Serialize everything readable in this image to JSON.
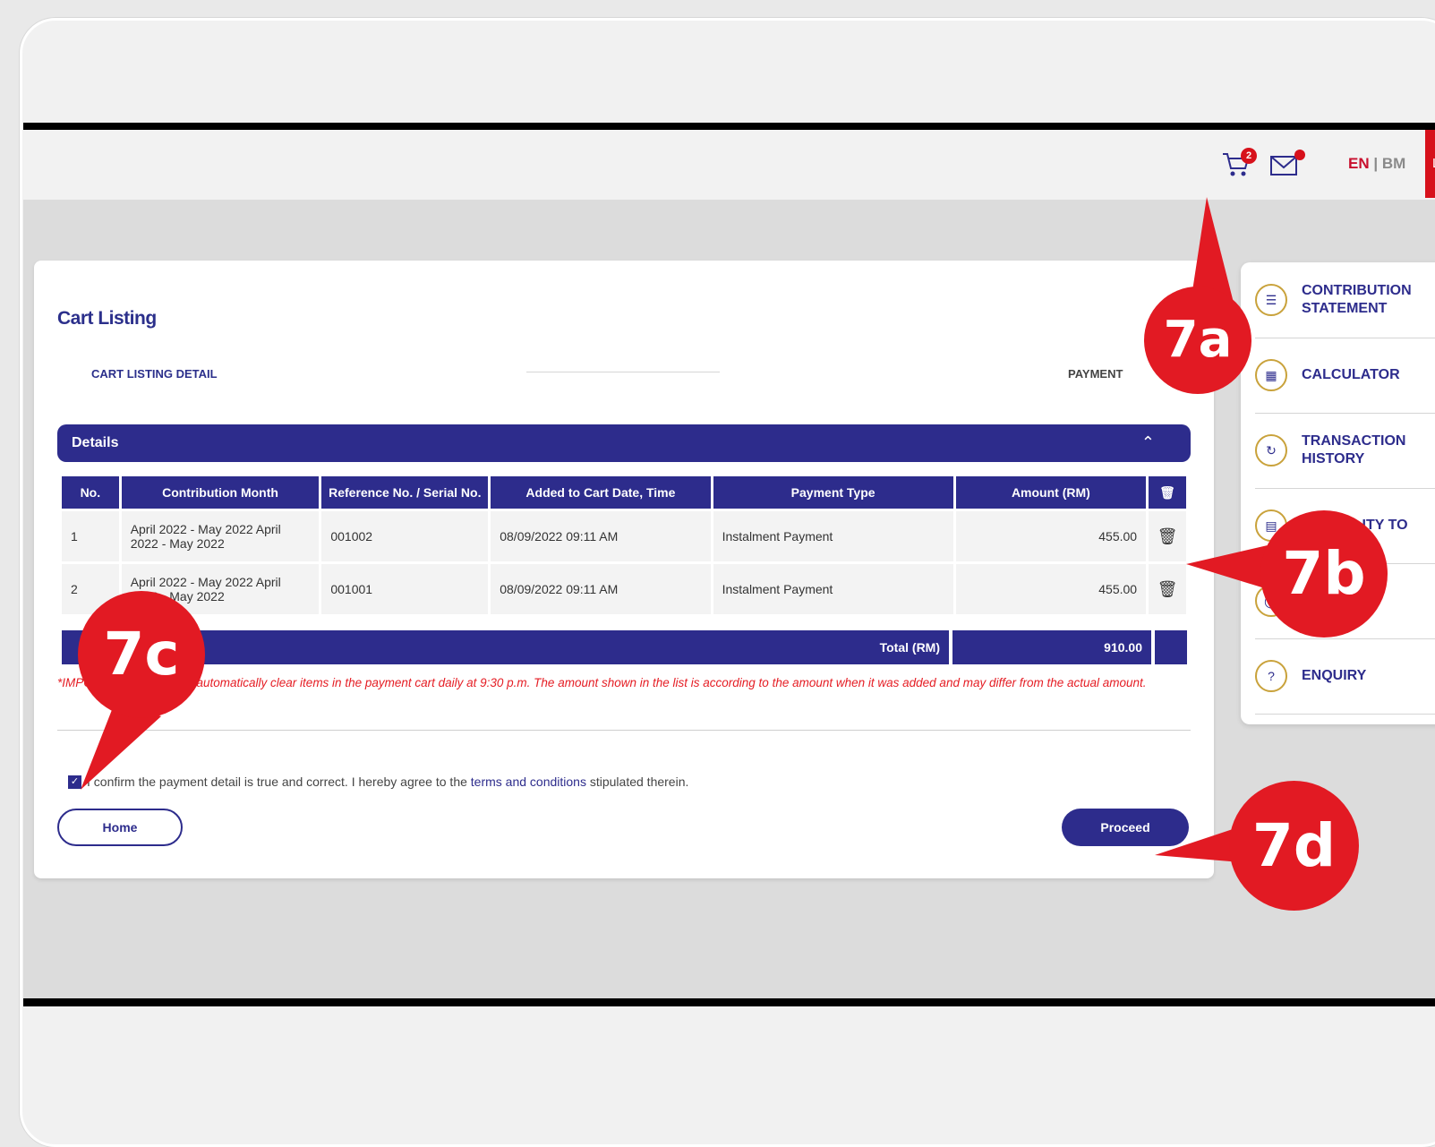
{
  "header": {
    "cart_badge": "2",
    "lang_en": "EN",
    "lang_sep": " | ",
    "lang_bm": "BM",
    "logout_label": "Log"
  },
  "page": {
    "title": "Cart Listing",
    "steps": [
      "CART LISTING DETAIL",
      "PAYMENT"
    ],
    "details_label": "Details",
    "columns": [
      "No.",
      "Contribution Month",
      "Reference No. / Serial No.",
      "Added to Cart Date, Time",
      "Payment Type",
      "Amount (RM)"
    ],
    "rows": [
      {
        "no": "1",
        "month": "April 2022 - May 2022 April 2022 - May 2022",
        "ref": "001002",
        "added": "08/09/2022 09:11 AM",
        "type": "Instalment Payment",
        "amount": "455.00"
      },
      {
        "no": "2",
        "month": "April 2022 - May 2022 April 2022 - May 2022",
        "ref": "001001",
        "added": "08/09/2022 09:11 AM",
        "type": "Instalment Payment",
        "amount": "455.00"
      }
    ],
    "total_label": "Total (RM)",
    "total_value": "910.00",
    "notice": "*IMPORTANT: KWSP will automatically clear items in the payment cart daily at 9:30 p.m. The amount shown in the list is according to the amount when it was added and may differ from the actual amount.",
    "confirm_prefix": "I confirm the payment detail is true and correct. I hereby agree to the ",
    "confirm_link": "terms and conditions",
    "confirm_suffix": " stipulated therein.",
    "home_button": "Home",
    "proceed_button": "Proceed"
  },
  "sidemenu": [
    {
      "label": "CONTRIBUTION STATEMENT",
      "icon": "document-icon"
    },
    {
      "label": "CALCULATOR",
      "icon": "calculator-icon"
    },
    {
      "label": "TRANSACTION HISTORY",
      "icon": "history-icon"
    },
    {
      "label": "ELIGIBILITY TO",
      "icon": "eligibility-icon"
    },
    {
      "label": "",
      "icon": "service-icon"
    },
    {
      "label": "ENQUIRY",
      "icon": "enquiry-icon"
    }
  ],
  "callouts": [
    "7a",
    "7b",
    "7c",
    "7d"
  ],
  "colors": {
    "primary": "#2d2c8c",
    "accent": "#d7111b",
    "callout": "#e21a23"
  }
}
